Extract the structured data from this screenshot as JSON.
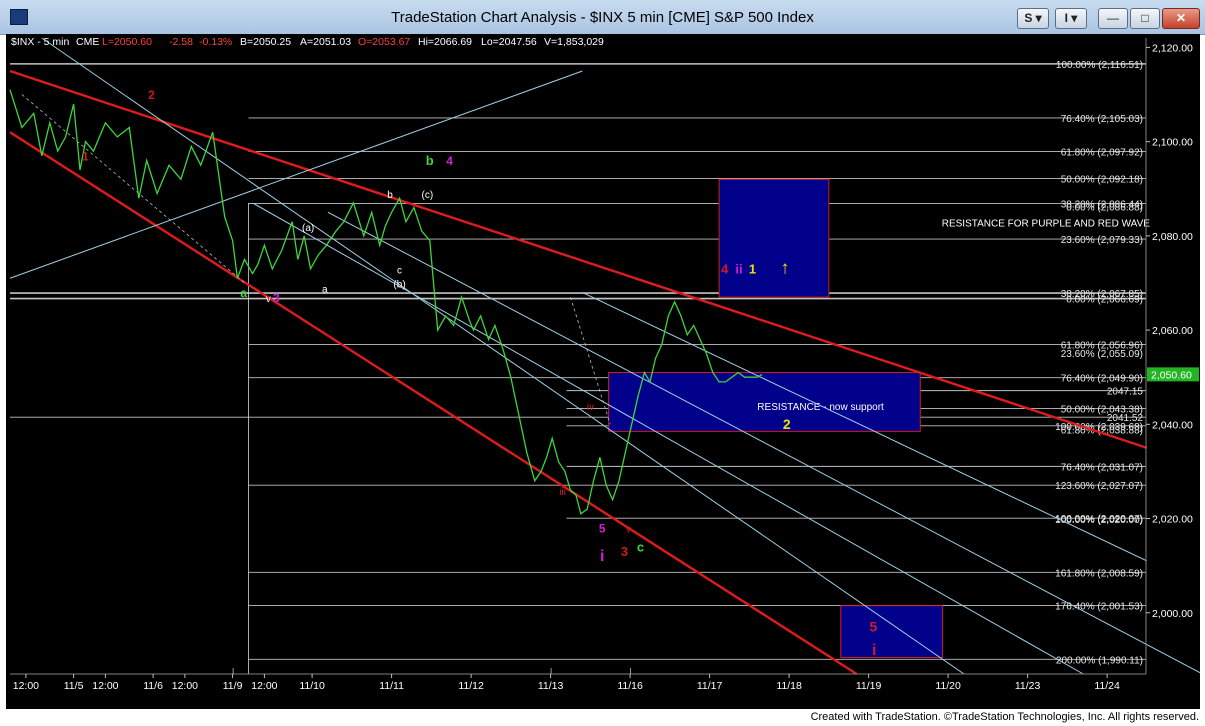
{
  "window": {
    "title": "TradeStation Chart Analysis - $INX 5 min [CME] S&P 500 Index",
    "tool_s_label": "S ▾",
    "tool_i_label": "I ▾",
    "min_label": "—",
    "max_label": "□",
    "close_label": "✕"
  },
  "status": {
    "symbol": "$INX - 5 min",
    "exchange": "CME",
    "last": "L=2050.60",
    "change": "-2.58",
    "pct": "-0.13%",
    "bid": "B=2050.25",
    "ask": "A=2051.03",
    "open": "O=2053.67",
    "high": "Hi=2066.69",
    "low": "Lo=2047.56",
    "volume": "V=1,853,029"
  },
  "credit": "Created with TradeStation. ©TradeStation Technologies, Inc. All rights reserved.",
  "colors": {
    "background": "#000000",
    "price": "#3cd63c",
    "channel": "#e01b1b",
    "parallel": "#9fd0e6",
    "fib": "#d8d8d8",
    "box_fill": "#00008b",
    "box_border": "#d01b1b",
    "axis_text": "#ffffff",
    "last_price_bg": "#22b422"
  },
  "chart_data": {
    "type": "line",
    "title": "$INX 5 min [CME] S&P 500 Index",
    "xlabel": "",
    "ylabel": "",
    "ylim": [
      1987,
      2122
    ],
    "y_ticks": [
      {
        "value": 2120,
        "label": "2,120.00"
      },
      {
        "value": 2100,
        "label": "2,100.00"
      },
      {
        "value": 2080,
        "label": "2,080.00"
      },
      {
        "value": 2060,
        "label": "2,060.00"
      },
      {
        "value": 2040,
        "label": "2,040.00"
      },
      {
        "value": 2020,
        "label": "2,020.00"
      },
      {
        "value": 2000,
        "label": "2,000.00"
      }
    ],
    "x_ticks": [
      {
        "t": 0.2,
        "label": "12:00"
      },
      {
        "t": 0.8,
        "label": "11/5"
      },
      {
        "t": 1.2,
        "label": "12:00"
      },
      {
        "t": 1.8,
        "label": "11/6"
      },
      {
        "t": 2.2,
        "label": "12:00"
      },
      {
        "t": 2.8,
        "label": "11/9"
      },
      {
        "t": 3.2,
        "label": "12:00"
      },
      {
        "t": 3.8,
        "label": "11/10"
      },
      {
        "t": 4.8,
        "label": "11/11"
      },
      {
        "t": 5.8,
        "label": "11/12"
      },
      {
        "t": 6.8,
        "label": "11/13"
      },
      {
        "t": 7.8,
        "label": "11/16"
      },
      {
        "t": 8.8,
        "label": "11/17"
      },
      {
        "t": 9.8,
        "label": "11/18"
      },
      {
        "t": 10.8,
        "label": "11/19"
      },
      {
        "t": 11.8,
        "label": "11/20"
      },
      {
        "t": 12.8,
        "label": "11/23"
      },
      {
        "t": 13.8,
        "label": "11/24"
      }
    ],
    "last_price": {
      "value": 2050.6,
      "label": "2,050.60"
    },
    "series": [
      {
        "x": [
          0.0,
          0.15,
          0.3,
          0.4,
          0.5,
          0.6,
          0.7,
          0.8,
          0.88,
          0.95,
          1.05,
          1.2,
          1.35,
          1.5,
          1.62,
          1.72,
          1.85,
          2.0,
          2.15,
          2.28,
          2.4,
          2.55,
          2.7,
          2.8,
          2.86,
          2.95,
          3.05,
          3.12,
          3.2,
          3.3,
          3.42,
          3.55,
          3.62,
          3.7,
          3.78,
          3.88,
          3.98,
          4.1,
          4.2,
          4.32,
          4.45,
          4.55,
          4.65,
          4.72,
          4.8,
          4.9,
          4.98,
          5.08,
          5.18,
          5.28,
          5.38,
          5.48,
          5.58,
          5.68,
          5.78,
          5.83,
          5.92,
          6.02,
          6.1,
          6.2,
          6.3,
          6.4,
          6.5,
          6.6,
          6.68,
          6.75,
          6.82,
          6.9,
          6.98,
          7.05,
          7.12,
          7.18,
          7.26,
          7.34,
          7.42,
          7.5,
          7.58,
          7.66,
          7.74,
          7.82,
          7.9,
          7.98,
          8.05,
          8.12,
          8.2,
          8.28,
          8.36,
          8.44,
          8.52,
          8.6,
          8.68,
          8.76,
          8.84,
          8.92,
          9.0,
          9.08,
          9.16,
          9.24,
          9.32,
          9.4,
          9.46
        ],
        "y": [
          2111,
          2103,
          2106,
          2097,
          2104,
          2098,
          2101,
          2108,
          2094,
          2100,
          2098,
          2104,
          2101,
          2103,
          2088,
          2096,
          2089,
          2095,
          2092,
          2099,
          2095,
          2102,
          2084,
          2079,
          2071,
          2075,
          2072,
          2074,
          2078,
          2073,
          2077,
          2083,
          2075,
          2080,
          2073,
          2076,
          2078,
          2081,
          2083,
          2087,
          2080,
          2085,
          2078,
          2082,
          2085,
          2088,
          2083,
          2086,
          2081,
          2079,
          2060,
          2063,
          2061,
          2067,
          2062,
          2060,
          2063,
          2058,
          2061,
          2056,
          2050,
          2042,
          2034,
          2028,
          2030,
          2033,
          2037,
          2032,
          2030,
          2026,
          2025,
          2021,
          2022,
          2028,
          2033,
          2027,
          2024,
          2028,
          2034,
          2040,
          2046,
          2051,
          2049,
          2054,
          2057,
          2063,
          2066,
          2063,
          2059,
          2061,
          2058,
          2055,
          2051,
          2049,
          2049,
          2050,
          2051,
          2050,
          2050,
          2050,
          2050.6
        ]
      }
    ],
    "annotations": [
      {
        "text": "RESISTANCE FOR PURPLE AND RED WAVE",
        "color": "#ffffff"
      },
      {
        "text": "RESISTANCE  - now support",
        "color": "#ffffff"
      },
      {
        "text": "1",
        "color": "#d01b1b"
      },
      {
        "text": "2",
        "color": "#d01b1b"
      },
      {
        "text": "a",
        "color": "#3cd63c"
      },
      {
        "text": "3",
        "color": "#d020d0"
      },
      {
        "text": "b",
        "color": "#3cd63c"
      },
      {
        "text": "4",
        "color": "#d020d0"
      },
      {
        "text": "(c)",
        "color": "#ffffff"
      },
      {
        "text": "(a)",
        "color": "#ffffff"
      },
      {
        "text": "a",
        "color": "#ffffff"
      },
      {
        "text": "b",
        "color": "#ffffff"
      },
      {
        "text": "c",
        "color": "#ffffff"
      },
      {
        "text": "(b)",
        "color": "#ffffff"
      },
      {
        "text": "v",
        "color": "#ffffff"
      },
      {
        "text": "iii",
        "color": "#d01b1b"
      },
      {
        "text": "iv",
        "color": "#d01b1b"
      },
      {
        "text": "5",
        "color": "#d020d0"
      },
      {
        "text": "i",
        "color": "#d020d0"
      },
      {
        "text": "v",
        "color": "#d01b1b"
      },
      {
        "text": "3",
        "color": "#d01b1b"
      },
      {
        "text": "c",
        "color": "#3cd63c"
      },
      {
        "text": "4",
        "color": "#d01b1b"
      },
      {
        "text": "ii",
        "color": "#d020d0"
      },
      {
        "text": "1",
        "color": "#f0e000"
      },
      {
        "text": "↑",
        "color": "#f0e000"
      },
      {
        "text": "2",
        "color": "#f0e000"
      },
      {
        "text": "5",
        "color": "#d01b1b"
      },
      {
        "text": "i",
        "color": "#d01b1b"
      }
    ],
    "fib_labels": [
      "100.00% (2,116.51)",
      "76.40% (2,105.03)",
      "61.80% (2,097.92)",
      "50.00% (2,092.18)",
      "38.20% (2,086.44)",
      "0.00% (2,086.88)",
      "23.60% (2,079.33)",
      "38.20% (2,067.85)",
      "0.00% (2,066.69)",
      "61.80% (2,056.96)",
      "23.60% (2,055.09)",
      "76.40% (2,049.90)",
      "2047.15",
      "50.00% (2,043.38)",
      "2041.52",
      "100.00% (2,039.68)",
      "61.80% (2,038.88)",
      "76.40% (2,031.07)",
      "123.60% (2,027.07)",
      "100.00% (2,020.07)",
      "100.00% (2,020.00)",
      "161.80% (2,008.59)",
      "176.40% (2,001.53)",
      "200.00% (1,990.11)"
    ]
  }
}
